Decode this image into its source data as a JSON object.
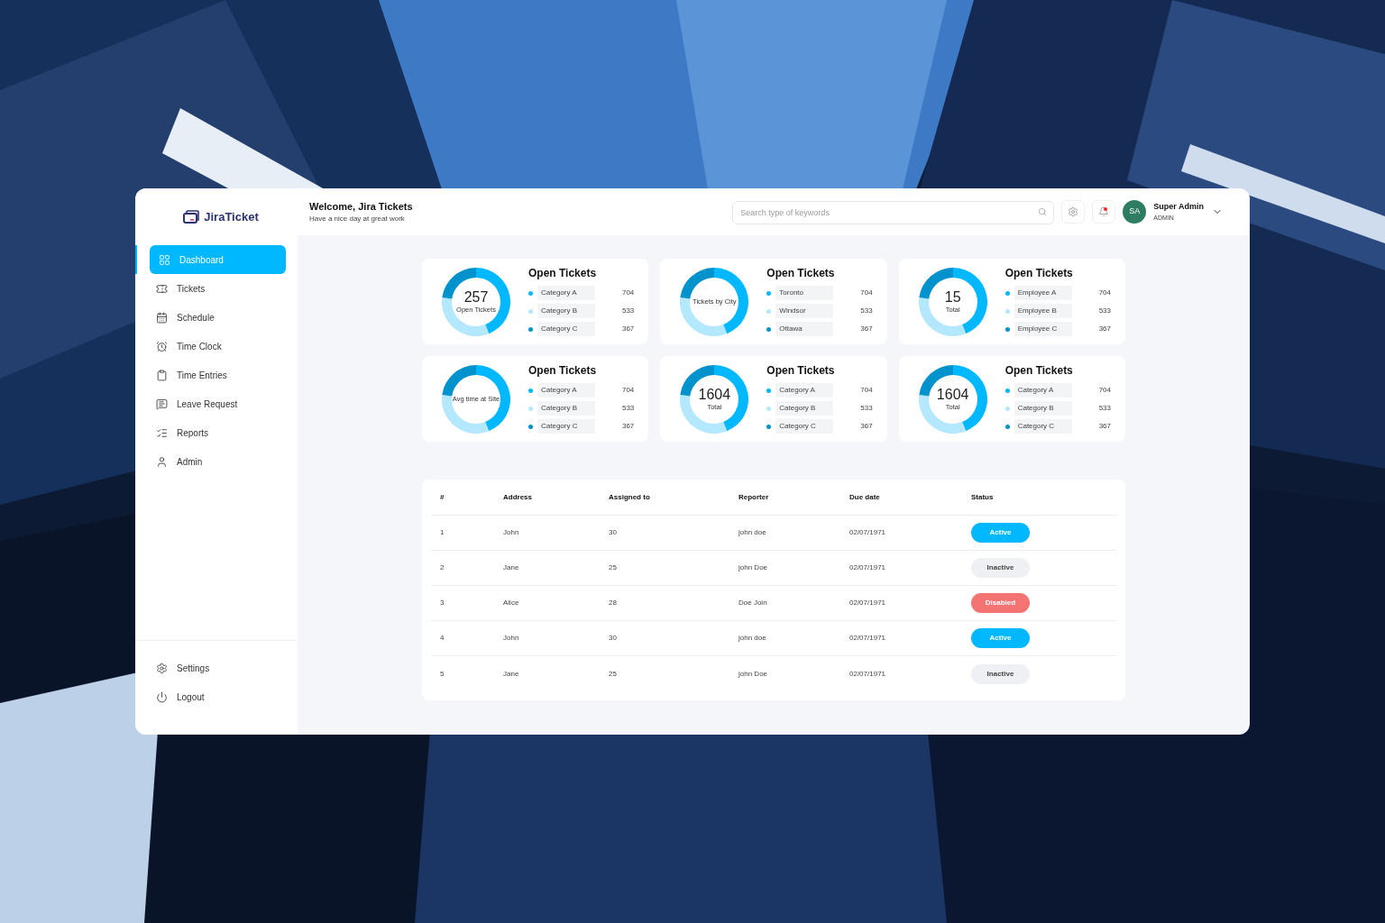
{
  "sidebar": {
    "logo": "JiraTicket",
    "items": [
      {
        "label": "Dashboard",
        "selected": true
      },
      {
        "label": "Tickets",
        "selected": false
      },
      {
        "label": "Schedule",
        "selected": false
      },
      {
        "label": "Time Clock",
        "selected": false
      },
      {
        "label": "Time Entries",
        "selected": false
      },
      {
        "label": "Leave Request",
        "selected": false
      },
      {
        "label": "Reports",
        "selected": false
      },
      {
        "label": "Admin",
        "selected": false
      }
    ],
    "bottom_items": [
      {
        "label": "Settings"
      },
      {
        "label": "Logout"
      }
    ]
  },
  "header": {
    "title": "Welcome, Jira Tickets",
    "subtitle": "Have a nice day at great work",
    "search": {
      "placeholder": "Search type of keywords"
    },
    "notifications": true,
    "user": {
      "initials": "SA",
      "name": "Super Admin",
      "role": "ADMIN"
    }
  },
  "cards": [
    {
      "center_value": "257",
      "center_label": "Open Tickets",
      "title": "Open Tickets",
      "legend": [
        {
          "label": "Category A",
          "value": "704",
          "color": "#00b8ff"
        },
        {
          "label": "Category B",
          "value": "533",
          "color": "#b3e8ff"
        },
        {
          "label": "Category C",
          "value": "367",
          "color": "#0092cc"
        }
      ],
      "chart_data": {
        "type": "donut",
        "values": [
          43.9,
          33.2,
          22.9
        ]
      }
    },
    {
      "center_label": "Tickets by City",
      "title": "Open Tickets",
      "legend": [
        {
          "label": "Toronto",
          "value": "704",
          "color": "#00b8ff"
        },
        {
          "label": "Windsor",
          "value": "533",
          "color": "#b3e8ff"
        },
        {
          "label": "Ottawa",
          "value": "367",
          "color": "#0092cc"
        }
      ],
      "chart_data": {
        "type": "donut",
        "values": [
          43.9,
          33.2,
          22.9
        ]
      }
    },
    {
      "center_value": "15",
      "center_label": "Total",
      "title": "Open Tickets",
      "legend": [
        {
          "label": "Employee A",
          "value": "704",
          "color": "#00b8ff"
        },
        {
          "label": "Employee B",
          "value": "533",
          "color": "#b3e8ff"
        },
        {
          "label": "Employee C",
          "value": "367",
          "color": "#0092cc"
        }
      ],
      "chart_data": {
        "type": "donut",
        "values": [
          43.9,
          33.2,
          22.9
        ]
      }
    },
    {
      "center_label": "Avg time at Site",
      "title": "Open Tickets",
      "legend": [
        {
          "label": "Category A",
          "value": "704",
          "color": "#00b8ff"
        },
        {
          "label": "Category B",
          "value": "533",
          "color": "#b3e8ff"
        },
        {
          "label": "Category C",
          "value": "367",
          "color": "#0092cc"
        }
      ],
      "chart_data": {
        "type": "donut",
        "values": [
          43.9,
          33.2,
          22.9
        ]
      }
    },
    {
      "center_value": "1604",
      "center_label": "Total",
      "title": "Open Tickets",
      "legend": [
        {
          "label": "Category A",
          "value": "704",
          "color": "#00b8ff"
        },
        {
          "label": "Category B",
          "value": "533",
          "color": "#b3e8ff"
        },
        {
          "label": "Category C",
          "value": "367",
          "color": "#0092cc"
        }
      ],
      "chart_data": {
        "type": "donut",
        "values": [
          43.9,
          33.2,
          22.9
        ]
      }
    },
    {
      "center_value": "1604",
      "center_label": "Total",
      "title": "Open Tickets",
      "legend": [
        {
          "label": "Category A",
          "value": "704",
          "color": "#00b8ff"
        },
        {
          "label": "Category B",
          "value": "533",
          "color": "#b3e8ff"
        },
        {
          "label": "Category C",
          "value": "367",
          "color": "#0092cc"
        }
      ],
      "chart_data": {
        "type": "donut",
        "values": [
          43.9,
          33.2,
          22.9
        ]
      }
    }
  ],
  "table": {
    "columns": [
      "#",
      "Address",
      "Assigned to",
      "Reporter",
      "Due date",
      "Status"
    ],
    "rows": [
      {
        "cells": [
          "1",
          "John",
          "30",
          "john doe",
          "02/07/1971"
        ],
        "status": {
          "label": "Active",
          "kind": "active"
        }
      },
      {
        "cells": [
          "2",
          "Jane",
          "25",
          "john Doe",
          "02/07/1971"
        ],
        "status": {
          "label": "Inactive",
          "kind": "inactive"
        }
      },
      {
        "cells": [
          "3",
          "Alice",
          "28",
          "Doe Join",
          "02/07/1971"
        ],
        "status": {
          "label": "Disabled",
          "kind": "disabled"
        }
      },
      {
        "cells": [
          "4",
          "John",
          "30",
          "john doe",
          "02/07/1971"
        ],
        "status": {
          "label": "Active",
          "kind": "active"
        }
      },
      {
        "cells": [
          "5",
          "Jane",
          "25",
          "john Doe",
          "02/07/1971"
        ],
        "status": {
          "label": "Inactive",
          "kind": "inactive"
        }
      }
    ]
  }
}
